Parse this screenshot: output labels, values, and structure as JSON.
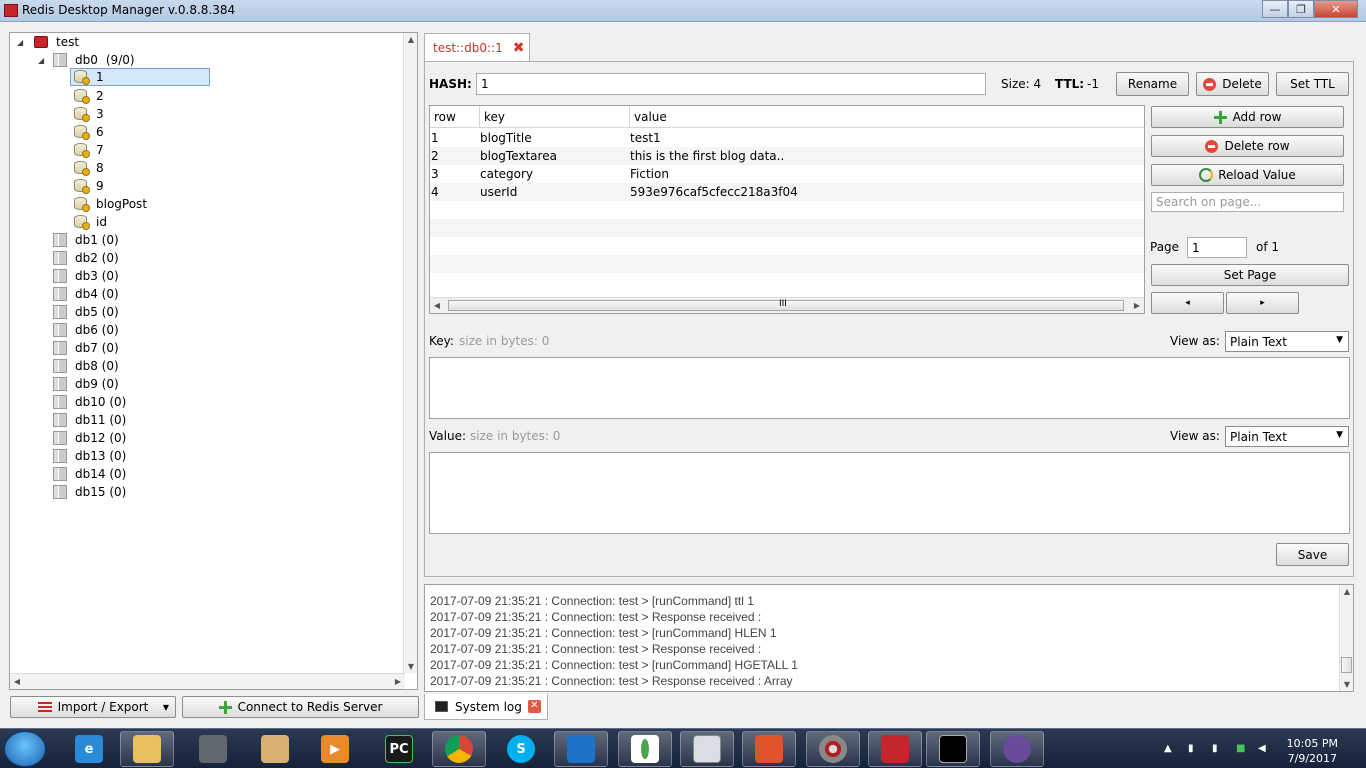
{
  "window": {
    "title": "Redis Desktop Manager v.0.8.8.384",
    "minimize": "—",
    "maximize": "❐",
    "close": "✕"
  },
  "tree": {
    "server": "test",
    "db0": {
      "label": "db0",
      "count": "(9/0)",
      "keys": [
        "1",
        "2",
        "3",
        "6",
        "7",
        "8",
        "9",
        "blogPost",
        "id"
      ]
    },
    "other_dbs": [
      "db1 (0)",
      "db2 (0)",
      "db3 (0)",
      "db4 (0)",
      "db5 (0)",
      "db6 (0)",
      "db7 (0)",
      "db8 (0)",
      "db9 (0)",
      "db10 (0)",
      "db11 (0)",
      "db12 (0)",
      "db13 (0)",
      "db14 (0)",
      "db15 (0)"
    ]
  },
  "left_buttons": {
    "import_export": "Import / Export",
    "connect": "Connect to Redis Server"
  },
  "tab": {
    "label": "test::db0::1",
    "close": "✖"
  },
  "key_header": {
    "type_label": "HASH:",
    "key_value": "1",
    "size": "Size: 4",
    "ttl_label": "TTL:",
    "ttl_value": "-1",
    "rename": "Rename",
    "delete": "Delete",
    "set_ttl": "Set TTL"
  },
  "table": {
    "columns": [
      "row",
      "key",
      "value"
    ],
    "rows": [
      {
        "row": "1",
        "key": "blogTitle",
        "value": "test1"
      },
      {
        "row": "2",
        "key": "blogTextarea",
        "value": "this is the first blog data.."
      },
      {
        "row": "3",
        "key": "category",
        "value": "Fiction"
      },
      {
        "row": "4",
        "key": "userId",
        "value": "593e976caf5cfecc218a3f04"
      }
    ],
    "scroll_grip": "III"
  },
  "side_controls": {
    "add_row": "Add row",
    "delete_row": "Delete row",
    "reload_value": "Reload Value",
    "search_placeholder": "Search on page...",
    "page_label": "Page",
    "page_value": "1",
    "page_of": "of 1",
    "set_page": "Set Page",
    "prev": "◂",
    "next": "▸"
  },
  "editor": {
    "key_label": "Key:",
    "key_size": "size in bytes: 0",
    "value_label": "Value:",
    "value_size": "size in bytes: 0",
    "view_as": "View as:",
    "view_mode": "Plain Text",
    "save": "Save"
  },
  "log": {
    "lines": [
      "2017-07-09 21:35:21 : Connection: test > [runCommand] ttl 1",
      "2017-07-09 21:35:21 : Connection: test > Response received :",
      "2017-07-09 21:35:21 : Connection: test > [runCommand] HLEN 1",
      "2017-07-09 21:35:21 : Connection: test > Response received :",
      "2017-07-09 21:35:21 : Connection: test > [runCommand] HGETALL 1",
      "2017-07-09 21:35:21 : Connection: test > Response received : Array"
    ],
    "tab_label": "System log",
    "tab_close": "✕"
  },
  "taskbar": {
    "time": "10:05 PM",
    "date": "7/9/2017",
    "apps": [
      "ie-icon",
      "explorer-icon",
      "scanner-icon",
      "mail-icon",
      "media-player-icon",
      "pycharm-icon",
      "chrome-icon",
      "skype-icon",
      "vscode-icon",
      "mongodb-icon",
      "app-window-icon",
      "presentation-icon",
      "disc-icon",
      "redis-icon",
      "cmd-icon",
      "github-icon"
    ],
    "pycharm_text": "PC"
  }
}
